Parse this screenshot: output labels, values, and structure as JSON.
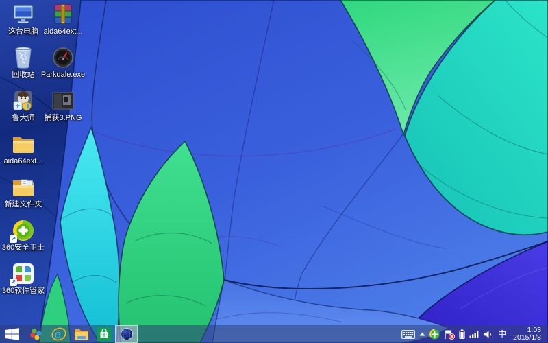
{
  "desktop": {
    "col1": [
      {
        "label": "这台电脑",
        "icon": "this-pc-icon"
      },
      {
        "label": "回收站",
        "icon": "recycle-bin-icon"
      },
      {
        "label": "鲁大师",
        "icon": "ludashi-icon"
      },
      {
        "label": "aida64ext...",
        "icon": "folder-icon"
      },
      {
        "label": "新建文件夹",
        "icon": "folder-with-files-icon"
      },
      {
        "label": "360安全卫士",
        "icon": "360-safe-guard-icon",
        "shortcut": true
      },
      {
        "label": "360软件管家",
        "icon": "360-software-manager-icon",
        "shortcut": true
      }
    ],
    "col2": [
      {
        "label": "aida64ext...",
        "icon": "winrar-archive-icon"
      },
      {
        "label": "Parkdale.exe",
        "icon": "gauge-icon"
      },
      {
        "label": "捕获3.PNG",
        "icon": "image-file-icon"
      }
    ]
  },
  "taskbar": {
    "buttons": [
      {
        "icon": "start-windows-logo-icon"
      },
      {
        "icon": "360-pinwheel-icon"
      },
      {
        "icon": "internet-explorer-icon"
      },
      {
        "icon": "file-explorer-icon"
      },
      {
        "icon": "windows-store-icon"
      },
      {
        "icon": "aida64-globe-icon",
        "active": true
      }
    ]
  },
  "tray": {
    "icons": [
      "touch-keyboard-icon",
      "chevron-up-icon",
      "360-tray-icon",
      "action-center-flag-alert-icon",
      "battery-icon",
      "network-signal-icon",
      "volume-icon",
      "ime-indicator"
    ],
    "ime_text": "中",
    "time": "1:03",
    "date": "2015/1/8"
  },
  "colors": {
    "wallpaper_navy": "#13297e",
    "wallpaper_blue": "#3155d6",
    "wallpaper_cyan": "#1fd0e0",
    "wallpaper_green": "#35dc88",
    "wallpaper_mint": "#24ddc2",
    "wallpaper_indigo": "#3a2cd4",
    "taskbar_tint": "rgba(46,64,116,0.55)"
  }
}
